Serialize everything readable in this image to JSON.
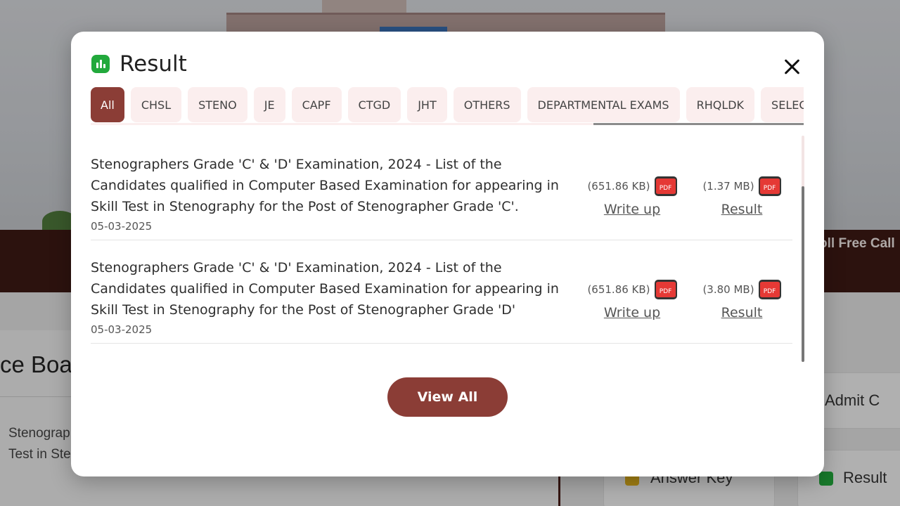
{
  "background": {
    "band_text": "oll Free Call",
    "heading": "ce Boa",
    "paragraph": "Stenograp... Result of ... appearing in Skill Test in Stenography.",
    "cards": {
      "admit_label": "Admit C",
      "answer_key_label": "Answer Key",
      "result_label": "Result"
    }
  },
  "modal": {
    "title": "Result",
    "title_icon": "bar-chart-icon",
    "close_icon": "close-icon",
    "tabs": [
      {
        "label": "All",
        "active": true
      },
      {
        "label": "CHSL"
      },
      {
        "label": "STENO"
      },
      {
        "label": "JE"
      },
      {
        "label": "CAPF"
      },
      {
        "label": "CTGD"
      },
      {
        "label": "JHT"
      },
      {
        "label": "OTHERS"
      },
      {
        "label": "DEPARTMENTAL EXAMS"
      },
      {
        "label": "RHQLDK"
      },
      {
        "label": "SELECTION POST"
      }
    ],
    "items": [
      {
        "title": "Stenographers Grade 'C' & 'D' Examination, 2024 - List of the Candidates qualified in Computer Based Examination for appearing in Skill Test in Stenography for the Post of Stenographer Grade 'C'.",
        "date": "05-03-2025",
        "writeup": {
          "size": "(651.86 KB)",
          "label": "Write up",
          "icon": "pdf-icon"
        },
        "result": {
          "size": "(1.37 MB)",
          "label": "Result",
          "icon": "pdf-icon"
        }
      },
      {
        "title": "Stenographers Grade 'C' & 'D' Examination, 2024 - List of the Candidates qualified in Computer Based Examination for appearing in Skill Test in Stenography for the Post of Stenographer Grade 'D'",
        "date": "05-03-2025",
        "writeup": {
          "size": "(651.86 KB)",
          "label": "Write up",
          "icon": "pdf-icon"
        },
        "result": {
          "size": "(3.80 MB)",
          "label": "Result",
          "icon": "pdf-icon"
        }
      }
    ],
    "pdf_label": "PDF",
    "view_all_label": "View All",
    "colors": {
      "accent": "#8b3d36",
      "tab_bg": "#fbeeee",
      "icon_green": "#22a93c",
      "pdf_red": "#e53935"
    }
  }
}
